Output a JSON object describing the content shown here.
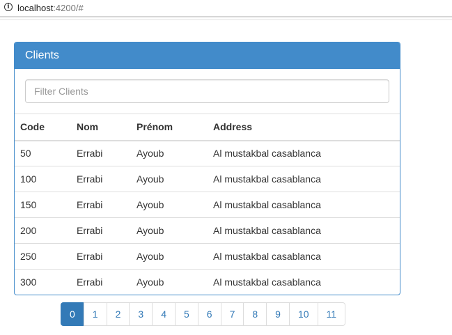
{
  "browser": {
    "url_host": "localhost",
    "url_path": ":4200/#"
  },
  "panel": {
    "title": "Clients",
    "filter_placeholder": "Filter Clients"
  },
  "table": {
    "columns": [
      "Code",
      "Nom",
      "Prénom",
      "Address"
    ],
    "rows": [
      [
        "50",
        "Errabi",
        "Ayoub",
        "Al mustakbal casablanca"
      ],
      [
        "100",
        "Errabi",
        "Ayoub",
        "Al mustakbal casablanca"
      ],
      [
        "150",
        "Errabi",
        "Ayoub",
        "Al mustakbal casablanca"
      ],
      [
        "200",
        "Errabi",
        "Ayoub",
        "Al mustakbal casablanca"
      ],
      [
        "250",
        "Errabi",
        "Ayoub",
        "Al mustakbal casablanca"
      ],
      [
        "300",
        "Errabi",
        "Ayoub",
        "Al mustakbal casablanca"
      ]
    ]
  },
  "pagination": {
    "pages": [
      "0",
      "1",
      "2",
      "3",
      "4",
      "5",
      "6",
      "7",
      "8",
      "9",
      "10",
      "11"
    ],
    "active": "0"
  },
  "colors": {
    "primary": "#428bca",
    "link": "#337ab7"
  }
}
